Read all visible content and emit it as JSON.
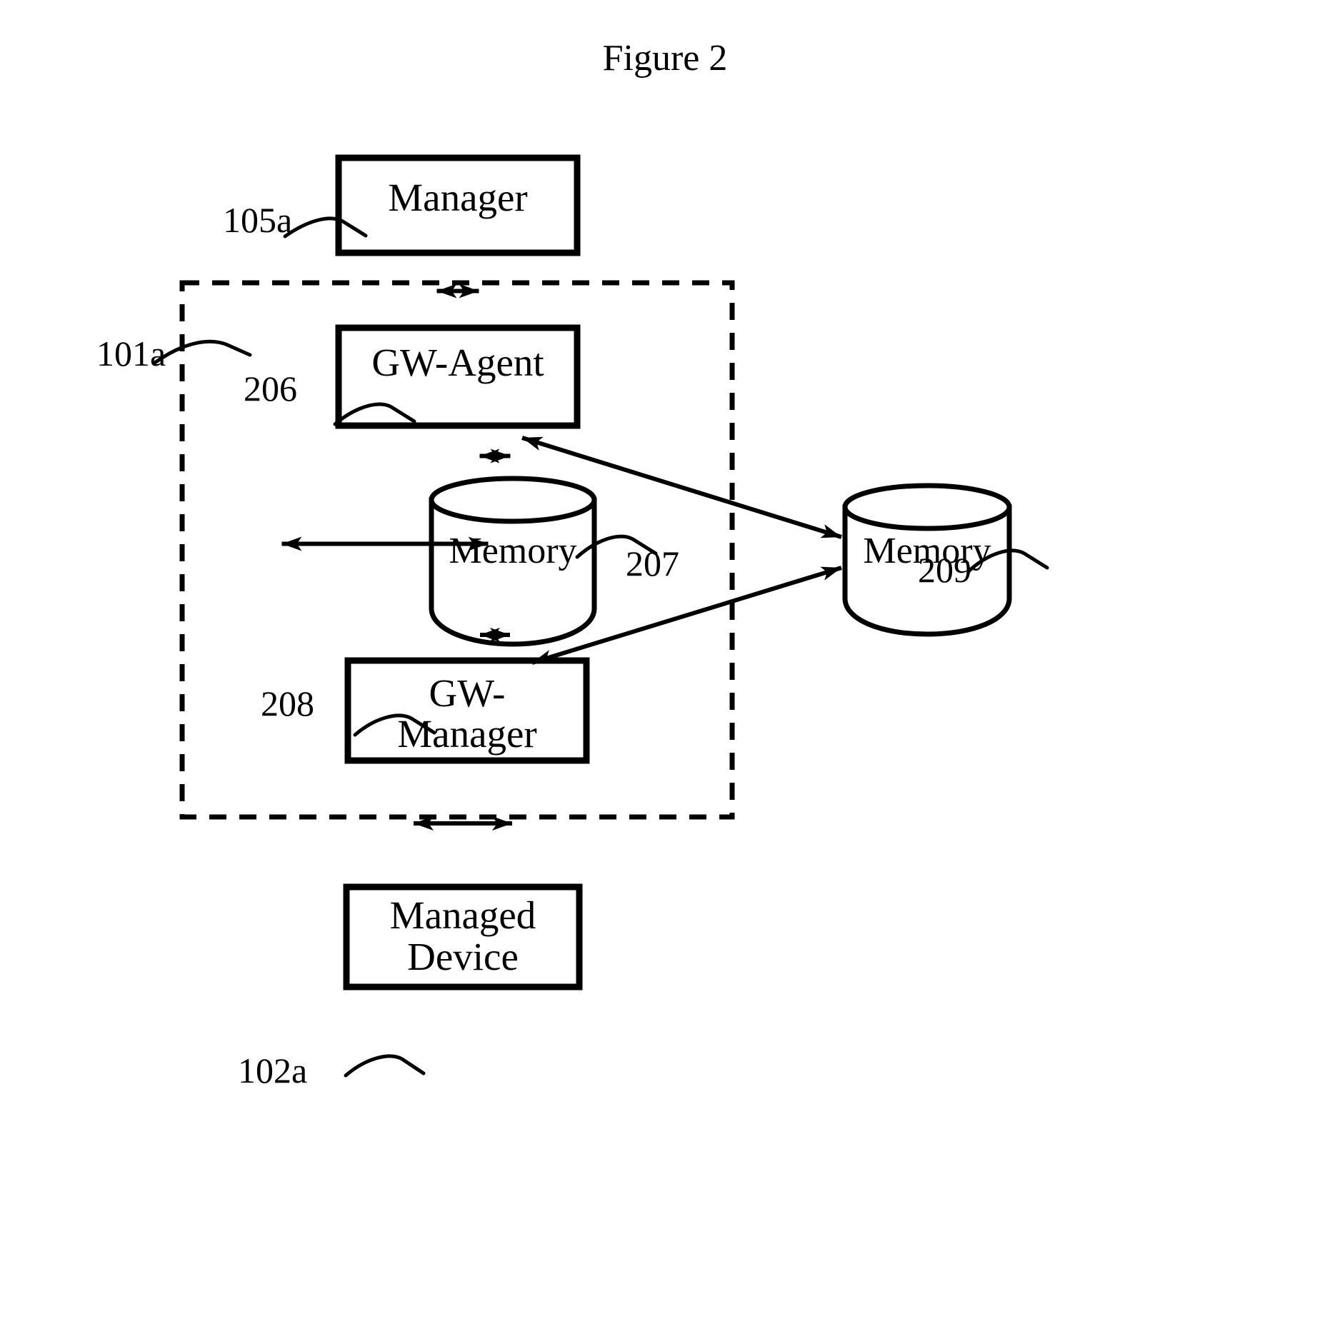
{
  "figure": {
    "title": "Figure 2",
    "background_color": "#ffffff",
    "line_color": "#000000"
  },
  "nodes": {
    "manager": {
      "label": "Manager",
      "ref": "105a"
    },
    "gw_agent": {
      "label": "GW-Agent",
      "ref": "206"
    },
    "gw_manager": {
      "label_line1": "GW-",
      "label_line2": "Manager",
      "ref": "208"
    },
    "managed_device": {
      "label_line1": "Managed",
      "label_line2": "Device",
      "ref": "102a"
    },
    "memory_internal": {
      "label": "Memory",
      "ref": "207"
    },
    "memory_external": {
      "label": "Memory",
      "ref": "209"
    },
    "gateway_boundary": {
      "ref": "101a"
    }
  }
}
